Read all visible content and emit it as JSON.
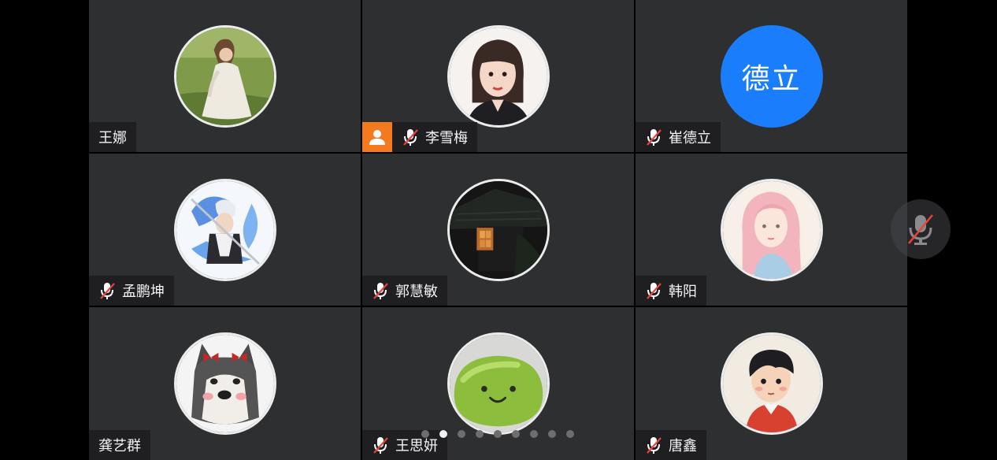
{
  "participants": [
    {
      "name": "王娜",
      "mic_muted": false,
      "is_host": false,
      "avatar": "photo-woman-white-dress"
    },
    {
      "name": "李雪梅",
      "mic_muted": true,
      "is_host": true,
      "avatar": "illustration-woman-dark-hair"
    },
    {
      "name": "崔德立",
      "mic_muted": true,
      "is_host": false,
      "avatar_text": "德立",
      "avatar_color": "#1a7dfb"
    },
    {
      "name": "孟鹏坤",
      "mic_muted": true,
      "is_host": false,
      "avatar": "anime-character"
    },
    {
      "name": "郭慧敏",
      "mic_muted": true,
      "is_host": false,
      "avatar": "night-house-window"
    },
    {
      "name": "韩阳",
      "mic_muted": true,
      "is_host": false,
      "avatar": "illustration-pink-hair-girl"
    },
    {
      "name": "龚艺群",
      "mic_muted": false,
      "is_host": false,
      "avatar": "husky-dog-with-bows"
    },
    {
      "name": "王思妍",
      "mic_muted": true,
      "is_host": false,
      "avatar": "green-blob-smile"
    },
    {
      "name": "唐鑫",
      "mic_muted": true,
      "is_host": false,
      "avatar": "cartoon-boy-red-hoodie"
    }
  ],
  "pagination": {
    "current_page": 2,
    "total_pages": 9
  },
  "colors": {
    "tile_bg": "#2e2f31",
    "host_badge": "#f37a1f",
    "muted_slash": "#e8443b",
    "text_avatar": "#1a7dfb"
  },
  "controls": {
    "self_mic_icon": "mic-muted-icon"
  }
}
